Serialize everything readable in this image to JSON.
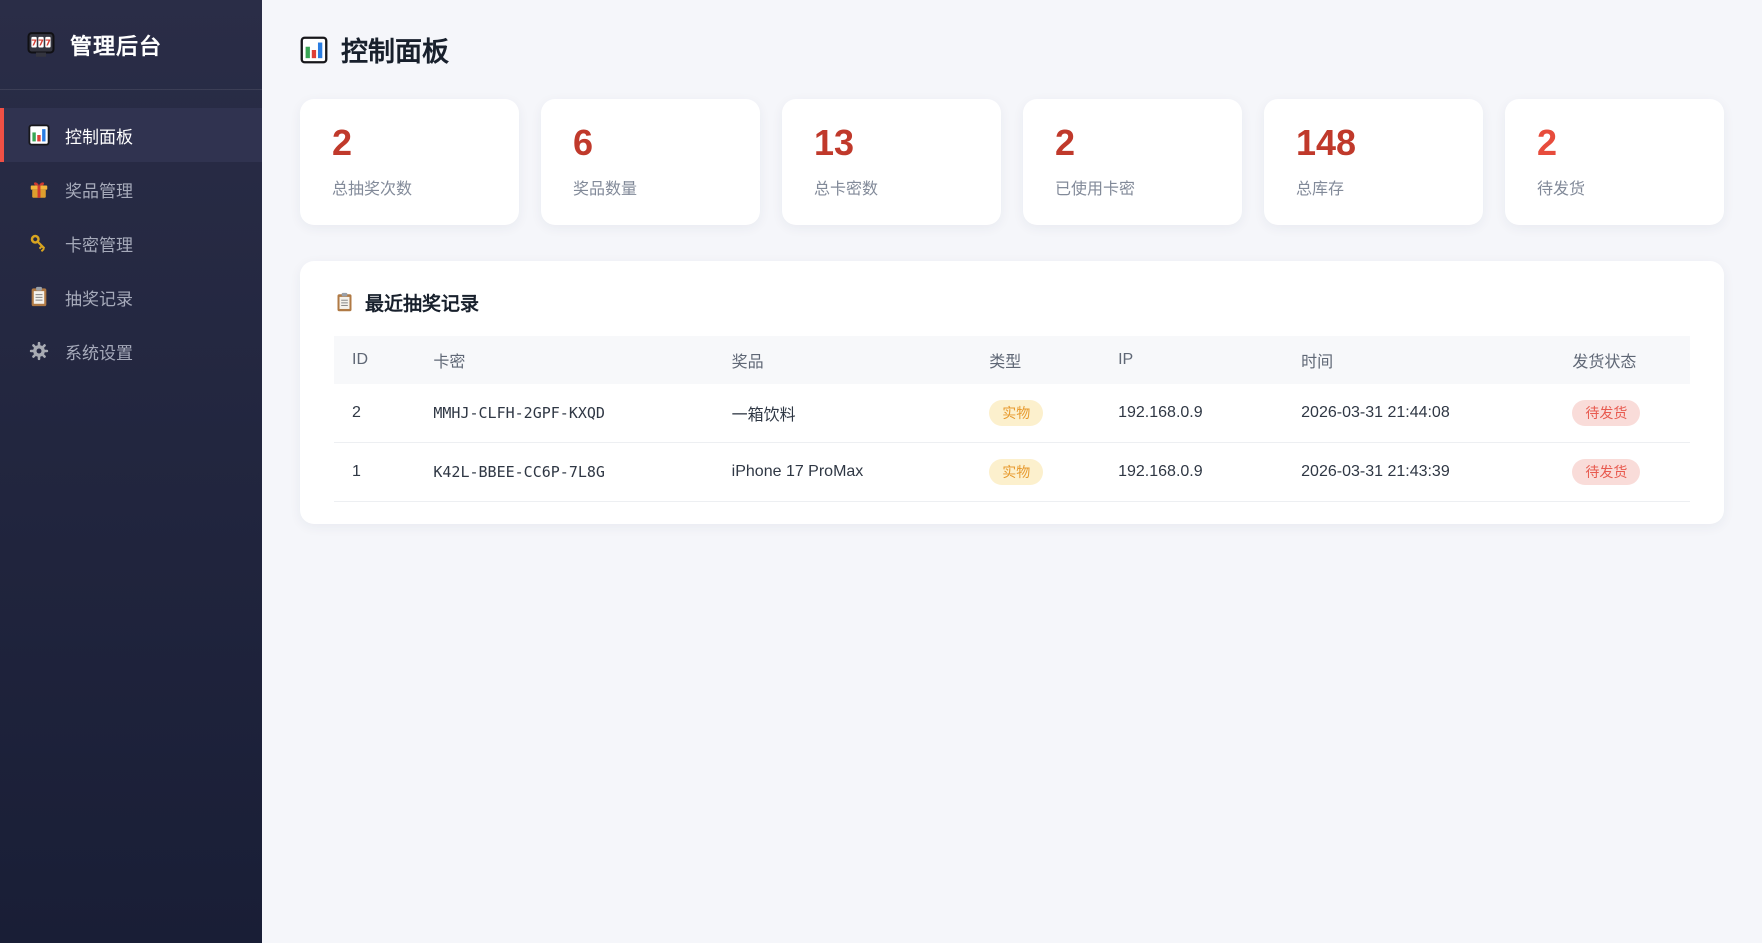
{
  "app": {
    "title": "管理后台",
    "logo_icon": "slot-machine-icon"
  },
  "sidebar": {
    "items": [
      {
        "label": "控制面板",
        "icon": "bar-chart-icon",
        "active": true
      },
      {
        "label": "奖品管理",
        "icon": "gift-icon",
        "active": false
      },
      {
        "label": "卡密管理",
        "icon": "key-icon",
        "active": false
      },
      {
        "label": "抽奖记录",
        "icon": "clipboard-icon",
        "active": false
      },
      {
        "label": "系统设置",
        "icon": "gear-icon",
        "active": false
      }
    ]
  },
  "page": {
    "title": "控制面板",
    "icon": "bar-chart-icon"
  },
  "stats": [
    {
      "value": "2",
      "label": "总抽奖次数",
      "color": "#c0392b"
    },
    {
      "value": "6",
      "label": "奖品数量",
      "color": "#c0392b"
    },
    {
      "value": "13",
      "label": "总卡密数",
      "color": "#c0392b"
    },
    {
      "value": "2",
      "label": "已使用卡密",
      "color": "#c0392b"
    },
    {
      "value": "148",
      "label": "总库存",
      "color": "#c0392b"
    },
    {
      "value": "2",
      "label": "待发货",
      "color": "#e74c3c"
    }
  ],
  "records": {
    "title": "最近抽奖记录",
    "icon": "clipboard-icon",
    "columns": [
      "ID",
      "卡密",
      "奖品",
      "类型",
      "IP",
      "时间",
      "发货状态"
    ],
    "rows": [
      {
        "id": "2",
        "key": "MMHJ-CLFH-2GPF-KXQD",
        "prize": "一箱饮料",
        "type": "实物",
        "ip": "192.168.0.9",
        "time": "2026-03-31 21:44:08",
        "status": "待发货"
      },
      {
        "id": "1",
        "key": "K42L-BBEE-CC6P-7L8G",
        "prize": "iPhone 17 ProMax",
        "type": "实物",
        "ip": "192.168.0.9",
        "time": "2026-03-31 21:43:39",
        "status": "待发货"
      }
    ]
  },
  "colors": {
    "sidebar_top": "#2a2d47",
    "sidebar_bottom": "#191e36",
    "active_accent": "#f05045",
    "stat_number": "#c0392b",
    "stat_number_alt": "#e74c3c",
    "type_badge_bg": "#fcf0cd",
    "type_badge_text": "#e79a2e",
    "status_badge_bg": "#f9dcd9",
    "status_badge_text": "#e85a4f",
    "page_background": "#f5f6fa"
  }
}
